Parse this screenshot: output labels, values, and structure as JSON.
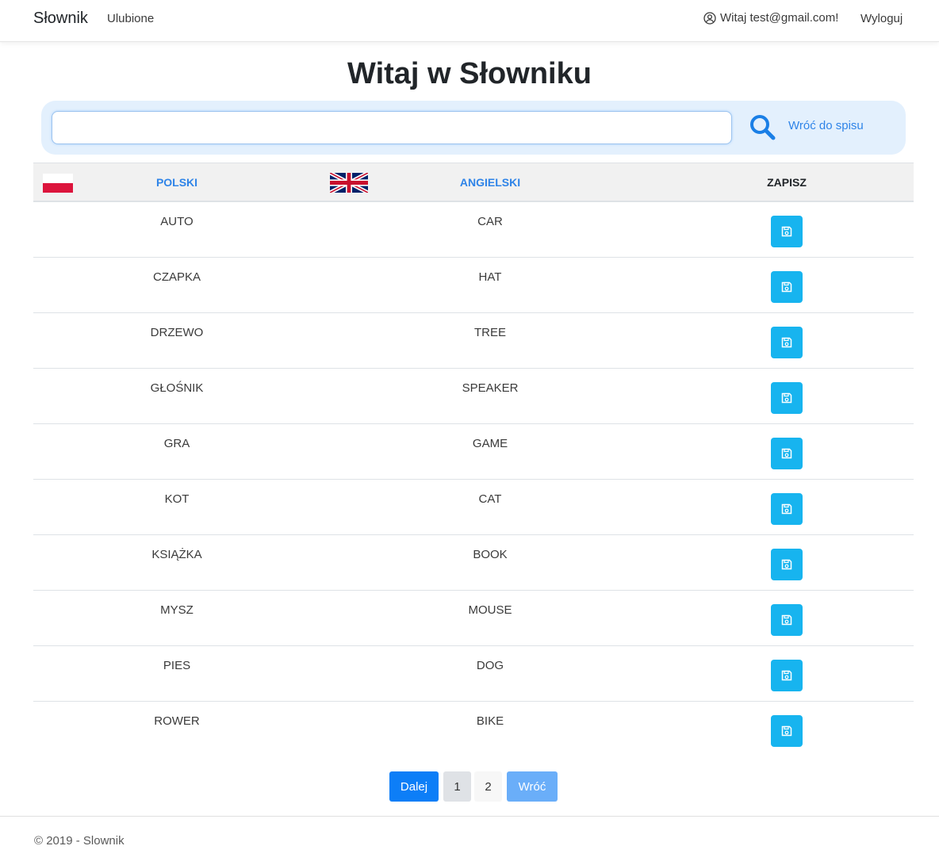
{
  "navbar": {
    "brand": "Słownik",
    "favorites": "Ulubione",
    "greeting": "Witaj test@gmail.com!",
    "logout": "Wyloguj"
  },
  "page": {
    "title": "Witaj w Słowniku"
  },
  "search": {
    "value": "",
    "placeholder": "",
    "back_label": "Wróć do spisu"
  },
  "table": {
    "headers": {
      "polish": "POLSKI",
      "english": "ANGIELSKI",
      "save": "ZAPISZ"
    },
    "rows": [
      {
        "pl": "AUTO",
        "en": "CAR"
      },
      {
        "pl": "CZAPKA",
        "en": "HAT"
      },
      {
        "pl": "DRZEWO",
        "en": "TREE"
      },
      {
        "pl": "GŁOŚNIK",
        "en": "SPEAKER"
      },
      {
        "pl": "GRA",
        "en": "GAME"
      },
      {
        "pl": "KOT",
        "en": "CAT"
      },
      {
        "pl": "KSIĄŻKA",
        "en": "BOOK"
      },
      {
        "pl": "MYSZ",
        "en": "MOUSE"
      },
      {
        "pl": "PIES",
        "en": "DOG"
      },
      {
        "pl": "ROWER",
        "en": "BIKE"
      }
    ]
  },
  "pagination": {
    "next": "Dalej",
    "page1": "1",
    "page2": "2",
    "back": "Wróć"
  },
  "footer": {
    "text": "© 2019 - Slownik"
  },
  "colors": {
    "link": "#2f84e8",
    "save_button": "#17b4ef",
    "primary": "#0d7ef7",
    "search_bg": "#e3f0fd"
  },
  "icons": {
    "user": "user-circle-icon",
    "search": "search-icon",
    "save": "floppy-disk-icon",
    "flag_pl": "poland-flag-icon",
    "flag_uk": "uk-flag-icon"
  }
}
